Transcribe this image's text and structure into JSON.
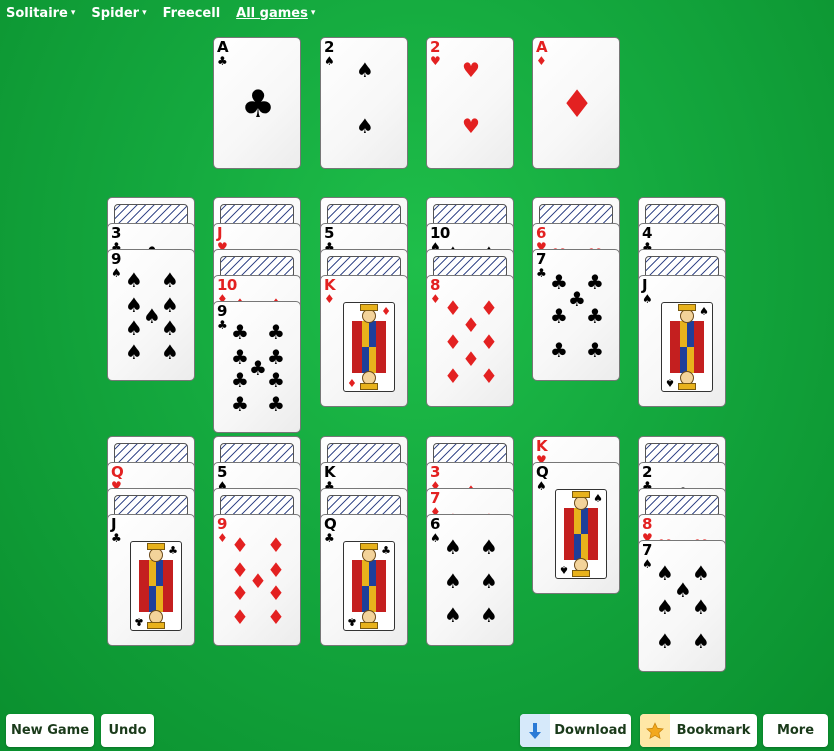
{
  "nav": [
    {
      "label": "Solitaire",
      "caret": "▾",
      "underlined": false
    },
    {
      "label": "Spider",
      "caret": "▾",
      "underlined": false
    },
    {
      "label": "Freecell",
      "caret": "",
      "underlined": false
    },
    {
      "label": "All games",
      "caret": "▾",
      "underlined": true
    }
  ],
  "foundations": [
    {
      "rank": "A",
      "suit": "clubs"
    },
    {
      "rank": "2",
      "suit": "spades"
    },
    {
      "rank": "2",
      "suit": "hearts"
    },
    {
      "rank": "A",
      "suit": "diamonds"
    }
  ],
  "tableau_top": [
    [
      {
        "down": true
      },
      {
        "rank": "3",
        "suit": "clubs"
      },
      {
        "rank": "9",
        "suit": "spades"
      }
    ],
    [
      {
        "down": true
      },
      {
        "rank": "J",
        "suit": "hearts"
      },
      {
        "down": true
      },
      {
        "rank": "10",
        "suit": "diamonds"
      },
      {
        "rank": "9",
        "suit": "clubs"
      }
    ],
    [
      {
        "down": true
      },
      {
        "rank": "5",
        "suit": "clubs"
      },
      {
        "down": true
      },
      {
        "rank": "K",
        "suit": "diamonds"
      }
    ],
    [
      {
        "down": true
      },
      {
        "rank": "10",
        "suit": "spades"
      },
      {
        "down": true
      },
      {
        "rank": "8",
        "suit": "diamonds"
      }
    ],
    [
      {
        "down": true
      },
      {
        "rank": "6",
        "suit": "hearts"
      },
      {
        "rank": "7",
        "suit": "clubs"
      }
    ],
    [
      {
        "down": true
      },
      {
        "rank": "4",
        "suit": "clubs"
      },
      {
        "down": true
      },
      {
        "rank": "J",
        "suit": "spades"
      }
    ]
  ],
  "tableau_bottom": [
    [
      {
        "down": true
      },
      {
        "rank": "Q",
        "suit": "hearts"
      },
      {
        "down": true
      },
      {
        "rank": "J",
        "suit": "clubs"
      }
    ],
    [
      {
        "down": true
      },
      {
        "rank": "5",
        "suit": "spades"
      },
      {
        "down": true
      },
      {
        "rank": "9",
        "suit": "diamonds"
      }
    ],
    [
      {
        "down": true
      },
      {
        "rank": "K",
        "suit": "clubs"
      },
      {
        "down": true
      },
      {
        "rank": "Q",
        "suit": "clubs"
      }
    ],
    [
      {
        "down": true
      },
      {
        "rank": "3",
        "suit": "diamonds"
      },
      {
        "rank": "7",
        "suit": "diamonds"
      },
      {
        "rank": "6",
        "suit": "spades"
      }
    ],
    [
      {
        "rank": "K",
        "suit": "hearts"
      },
      {
        "rank": "Q",
        "suit": "spades"
      }
    ],
    [
      {
        "down": true
      },
      {
        "rank": "2",
        "suit": "clubs"
      },
      {
        "down": true
      },
      {
        "rank": "8",
        "suit": "hearts"
      },
      {
        "rank": "7",
        "suit": "spades"
      }
    ]
  ],
  "buttons": {
    "new_game": "New Game",
    "undo": "Undo",
    "download": "Download",
    "bookmark": "Bookmark",
    "more": "More"
  },
  "colors": {
    "table_green": "#14a83e",
    "red_suit": "#e32121",
    "download_icon_bg": "#d6e9fa",
    "download_icon": "#2a7ad6",
    "bookmark_icon_bg": "#ffe7a6",
    "bookmark_icon": "#f2a81d"
  }
}
